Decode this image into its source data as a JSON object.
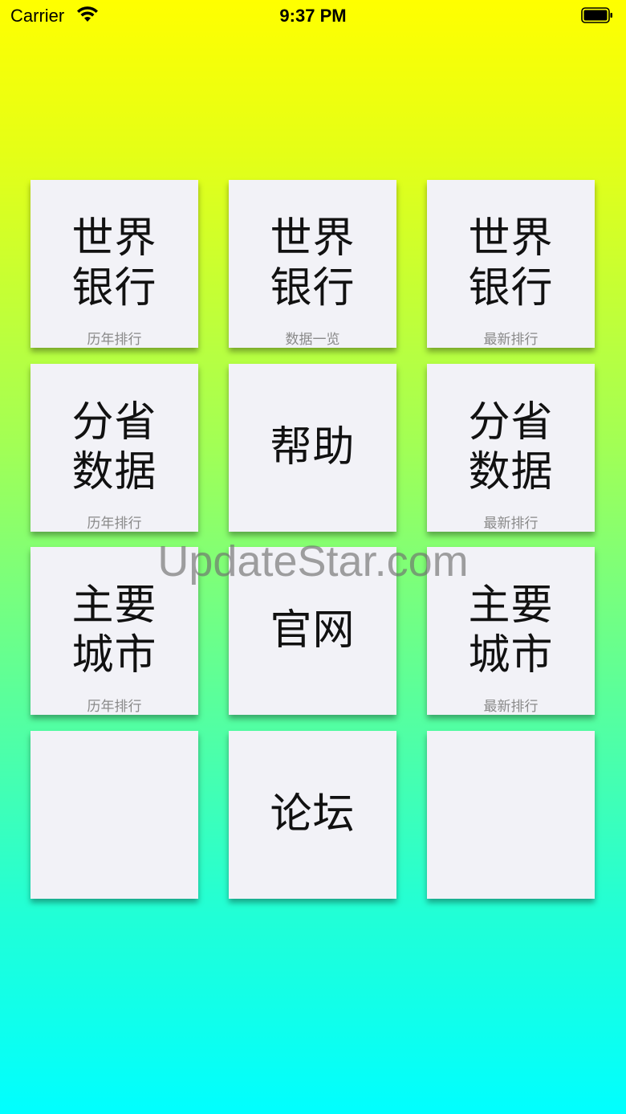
{
  "status_bar": {
    "carrier": "Carrier",
    "time": "9:37 PM"
  },
  "tiles": [
    {
      "title": "世界\n银行",
      "subtitle": "历年排行"
    },
    {
      "title": "世界\n银行",
      "subtitle": "数据一览"
    },
    {
      "title": "世界\n银行",
      "subtitle": "最新排行"
    },
    {
      "title": "分省\n数据",
      "subtitle": "历年排行"
    },
    {
      "title": "帮助",
      "subtitle": ""
    },
    {
      "title": "分省\n数据",
      "subtitle": "最新排行"
    },
    {
      "title": "主要\n城市",
      "subtitle": "历年排行"
    },
    {
      "title": "官网",
      "subtitle": ""
    },
    {
      "title": "主要\n城市",
      "subtitle": "最新排行"
    },
    {
      "title": "",
      "subtitle": ""
    },
    {
      "title": "论坛",
      "subtitle": ""
    },
    {
      "title": "",
      "subtitle": ""
    }
  ],
  "watermark": "UpdateStar.com",
  "colors": {
    "gradient_top": "#ffff00",
    "gradient_bottom": "#00ffff",
    "tile_background": "#f2f2f7"
  }
}
